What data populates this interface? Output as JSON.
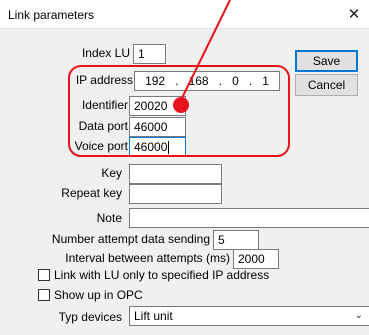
{
  "window": {
    "title": "Link parameters",
    "close_glyph": "✕",
    "close_icon": "close-icon"
  },
  "fields": {
    "index_lu": {
      "label": "Index LU",
      "value": "1"
    },
    "ip_address": {
      "label": "IP address",
      "octets": [
        "192",
        "168",
        "0",
        "1"
      ],
      "separator": "."
    },
    "identifier": {
      "label": "Identifier",
      "value": "20020"
    },
    "data_port": {
      "label": "Data port",
      "value": "46000"
    },
    "voice_port": {
      "label": "Voice port",
      "value": "46000"
    },
    "key": {
      "label": "Key",
      "value": ""
    },
    "repeat_key": {
      "label": "Repeat key",
      "value": ""
    },
    "note": {
      "label": "Note",
      "value": ""
    },
    "attempts": {
      "label": "Number attempt data sending",
      "value": "5"
    },
    "interval": {
      "label": "Interval between attempts (ms)",
      "value": "2000"
    }
  },
  "checkboxes": {
    "link_lu_only": {
      "label": "Link  with LU only to specified IP address",
      "checked": false
    },
    "show_opc": {
      "label": "Show up in OPC",
      "checked": false
    }
  },
  "device_type": {
    "label": "Typ devices",
    "selected": "Lift unit",
    "icon": "chevron-down-icon"
  },
  "buttons": {
    "save": "Save",
    "cancel": "Cancel"
  },
  "annotation": {
    "color": "#e8121a"
  }
}
